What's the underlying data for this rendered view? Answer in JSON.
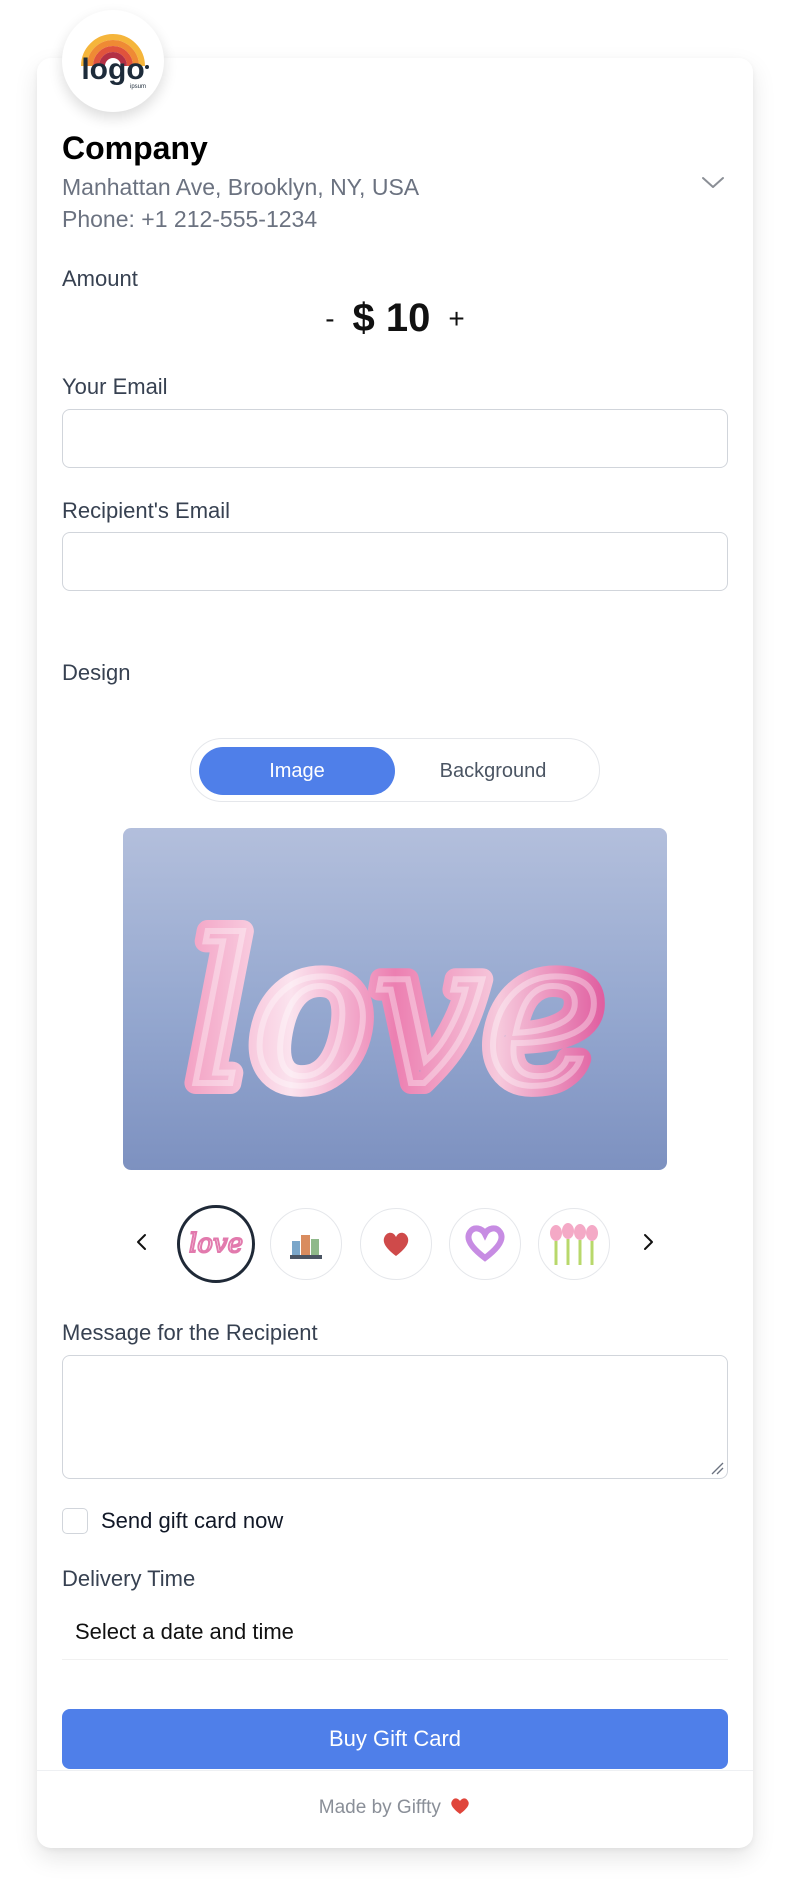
{
  "company": {
    "logo_text": "logo",
    "logo_subtext": "ipsum",
    "name": "Company",
    "address": "Manhattan Ave, Brooklyn, NY, USA",
    "phone": "Phone: +1 212-555-1234"
  },
  "amount": {
    "label": "Amount",
    "minus": "-",
    "value": "$ 10",
    "plus": "+"
  },
  "fields": {
    "your_email_label": "Your Email",
    "your_email_value": "",
    "recipient_email_label": "Recipient's Email",
    "recipient_email_value": ""
  },
  "design": {
    "label": "Design",
    "tabs": [
      "Image",
      "Background"
    ],
    "active_tab": "Image",
    "hero_word": "love",
    "thumbnails": [
      "love-thumbnail",
      "city-thumbnail",
      "heart-thumbnail",
      "purple-heart-thumbnail",
      "tulips-thumbnail"
    ],
    "selected_thumbnail": 0
  },
  "message": {
    "label": "Message for the Recipient",
    "value": ""
  },
  "send_now": {
    "label": "Send gift card now",
    "checked": false
  },
  "delivery": {
    "label": "Delivery Time",
    "placeholder": "Select a date and time"
  },
  "buy_button": "Buy Gift Card",
  "footer": "Made by Giffty",
  "colors": {
    "accent": "#4f7fe9",
    "text_muted": "#6b7280",
    "border": "#d1d5db"
  }
}
